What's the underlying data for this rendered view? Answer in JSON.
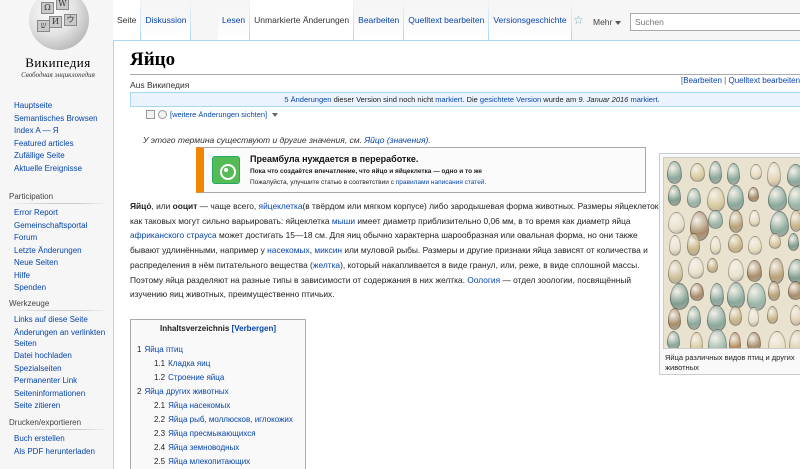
{
  "logo": {
    "wordmark": "Википедия",
    "tagline": "Свободная энциклопедия",
    "piece_glyphs": [
      "Ω",
      "W",
      "И",
      "ウ",
      "ש"
    ]
  },
  "nav": {
    "main": [
      "Hauptseite",
      "Semantisches Browsen",
      "Index A — Я",
      "Featured articles",
      "Zufällige Seite",
      "Aktuelle Ereignisse"
    ],
    "participation_title": "Participation",
    "participation": [
      "Error Report",
      "Gemeinschaftsportal",
      "Forum",
      "Letzte Änderungen",
      "Neue Seiten",
      "Hilfe",
      "Spenden"
    ],
    "tools_title": "Werkzeuge",
    "tools": [
      "Links auf diese Seite",
      "Änderungen an verlinkten Seiten",
      "Datei hochladen",
      "Spezialseiten",
      "Permanenter Link",
      "Seiteninformationen",
      "Seite zitieren"
    ],
    "print_title": "Drucken/exportieren",
    "print": [
      "Buch erstellen",
      "Als PDF herunterladen"
    ]
  },
  "tabs": {
    "left": [
      "Seite",
      "Diskussion"
    ],
    "right": [
      "Lesen",
      "Unmarkierte Änderungen",
      "Bearbeiten",
      "Quelltext bearbeiten",
      "Versionsgeschichte"
    ],
    "selected": "Unmarkierte Änderungen",
    "more": "Mehr",
    "search_placeholder": "Suchen"
  },
  "article": {
    "title": "Яйцо",
    "site_sub": "Aus Википедия",
    "edit_links": {
      "open": "[",
      "edit": "Bearbeiten",
      "sep": " | ",
      "source": "Quelltext bearbeiten",
      "close": "]"
    },
    "flagged": {
      "changes": "5 Änderungen",
      "t1": " dieser Version sind noch nicht ",
      "marked": "markiert",
      "t2": ". Die ",
      "sighted": "gesichtete Version",
      "t3": " wurde am ",
      "date": "9. Januar 2016",
      "t4": " ",
      "marked2": "markiert",
      "t5": "."
    },
    "review_toggle": "[weitere Änderungen sichten]",
    "hatnote": {
      "prefix": "У этого термина существуют и другие значения, см. ",
      "link": "Яйцо (значения)",
      "suffix": "."
    },
    "ambox": {
      "title": "Преамбула нуждается в переработке.",
      "line2": "Пока что создаётся впечатление, что яйцо и яйцеклетка — одно и то же",
      "line3_prefix": "Пожалуйста, улучшите статью в соответствии с ",
      "line3_link": "правилами написания статей",
      "line3_suffix": "."
    },
    "lede": {
      "s0": "Яйцо́",
      "s1": ", или ",
      "s2": "ооцит",
      "s3": " — чаще всего, ",
      "l1": "яйцеклетка",
      "s4": "(в твёрдом или мягком корпусе) либо зародышевая форма животных. Размеры яйцеклеток как таковых могут сильно варьировать: яйцеклетка ",
      "l2": "мыши",
      "s5": " имеет диаметр приблизительно 0,06 мм, в то время как диаметр яйца ",
      "l3": "африканского страуса",
      "s6": " может достигать 15—18 см. Для яиц обычно характерна шарообразная или овальная форма, но они также бывают удлинёнными, например у ",
      "l4": "насекомых",
      "s7": ", ",
      "l5": "миксин",
      "s8": " или муловой рыбы. Размеры и другие признаки яйца зависят от количества и распределения в нём питательного вещества (",
      "l6": "желтка",
      "s9": "), который накапливается в виде гранул, или, реже, в виде сплошной массы. Поэтому яйца разделяют на разные типы в зависимости от содержания в них желтка. ",
      "l7": "Оология",
      "s10": " — отдел зоологии, посвящённый изучению яиц животных, преимущественно птичьих."
    },
    "toc": {
      "title": "Inhaltsverzeichnis",
      "hide": "[Verbergen]",
      "items": [
        {
          "num": "1",
          "label": "Яйца птиц",
          "level": 1
        },
        {
          "num": "1.1",
          "label": "Кладка яиц",
          "level": 2
        },
        {
          "num": "1.2",
          "label": "Строение яйца",
          "level": 2
        },
        {
          "num": "2",
          "label": "Яйца других животных",
          "level": 1
        },
        {
          "num": "2.1",
          "label": "Яйца насекомых",
          "level": 2
        },
        {
          "num": "2.2",
          "label": "Яйца рыб, моллюсков, иглокожих",
          "level": 2
        },
        {
          "num": "2.3",
          "label": "Яйца пресмыкающихся",
          "level": 2
        },
        {
          "num": "2.4",
          "label": "Яйца земноводных",
          "level": 2
        },
        {
          "num": "2.5",
          "label": "Яйца млекопитающих",
          "level": 2
        }
      ]
    },
    "thumb_caption": "Яйца различных видов птиц и других животных"
  },
  "colors": {
    "link": "#0645ad",
    "ambox_accent": "#f28500",
    "flagged_bg": "#eaf3ff"
  }
}
